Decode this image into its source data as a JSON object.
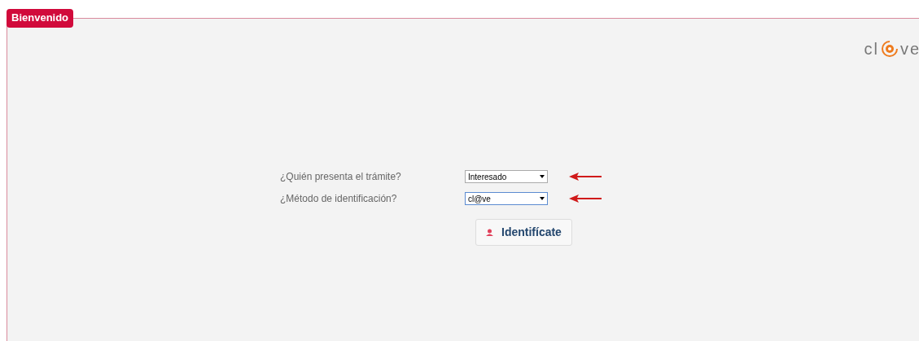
{
  "panel": {
    "title": "Bienvenido"
  },
  "logo": {
    "text_before": "cl",
    "text_after": "ve"
  },
  "form_rows": [
    {
      "label": "¿Quién presenta el trámite?",
      "value": "Interesado",
      "focused": false
    },
    {
      "label": "¿Método de identificación?",
      "value": "cl@ve",
      "focused": true
    }
  ],
  "submit_button": {
    "label": "Identifícate"
  }
}
